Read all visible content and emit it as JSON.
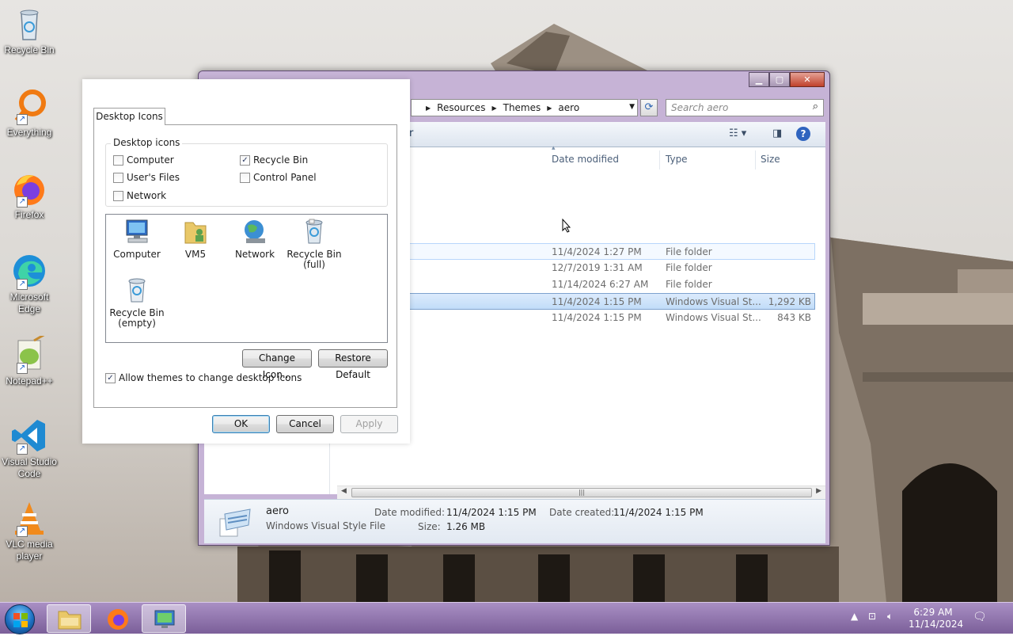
{
  "desktop": {
    "icons": [
      {
        "label": "Recycle Bin",
        "icon": "recycle-bin-icon"
      },
      {
        "label": "Everything",
        "icon": "everything-search-icon"
      },
      {
        "label": "Firefox",
        "icon": "firefox-icon"
      },
      {
        "label": "Microsoft Edge",
        "icon": "edge-icon"
      },
      {
        "label": "Notepad++",
        "icon": "notepad-plus-plus-icon"
      },
      {
        "label": "Visual Studio Code",
        "icon": "vscode-icon"
      },
      {
        "label": "VLC media player",
        "icon": "vlc-icon"
      }
    ]
  },
  "explorer": {
    "breadcrumb": [
      "Resources",
      "Themes",
      "aero"
    ],
    "search_placeholder": "Search aero",
    "toolbar_fragment": "r",
    "columns": {
      "date": "Date modified",
      "type": "Type",
      "size": "Size"
    },
    "rows": [
      {
        "date": "11/4/2024 1:27 PM",
        "type": "File folder",
        "size": ""
      },
      {
        "date": "12/7/2019 1:31 AM",
        "type": "File folder",
        "size": ""
      },
      {
        "date": "11/14/2024 6:27 AM",
        "type": "File folder",
        "size": ""
      },
      {
        "date": "11/4/2024 1:15 PM",
        "type": "Windows Visual St...",
        "size": "1,292 KB"
      },
      {
        "date": "11/4/2024 1:15 PM",
        "type": "Windows Visual St...",
        "size": "843 KB"
      }
    ],
    "details": {
      "name": "aero",
      "kind": "Windows Visual Style File",
      "date_modified_label": "Date modified:",
      "date_modified": "11/4/2024 1:15 PM",
      "date_created_label": "Date created:",
      "date_created": "11/4/2024 1:15 PM",
      "size_label": "Size:",
      "size": "1.26 MB"
    }
  },
  "dialog": {
    "tab": "Desktop Icons",
    "group_title": "Desktop icons",
    "checkboxes": [
      {
        "label": "Computer",
        "checked": false
      },
      {
        "label": "Recycle Bin",
        "checked": true
      },
      {
        "label": "User's Files",
        "checked": false
      },
      {
        "label": "Control Panel",
        "checked": false
      },
      {
        "label": "Network",
        "checked": false
      }
    ],
    "icon_items": [
      {
        "label": "Computer",
        "icon": "computer-icon"
      },
      {
        "label": "VM5",
        "icon": "user-folder-icon"
      },
      {
        "label": "Network",
        "icon": "network-icon"
      },
      {
        "label": "Recycle Bin",
        "sublabel": "(full)",
        "icon": "recycle-bin-full-icon"
      },
      {
        "label": "Recycle Bin",
        "sublabel": "(empty)",
        "icon": "recycle-bin-empty-icon"
      }
    ],
    "change_icon": "Change Icon...",
    "restore_default": "Restore Default",
    "allow_themes": "Allow themes to change desktop icons",
    "allow_themes_checked": true,
    "ok": "OK",
    "cancel": "Cancel",
    "apply": "Apply"
  },
  "taskbar": {
    "time": "6:29 AM",
    "date": "11/14/2024"
  },
  "colors": {
    "taskbar": "#8e72ad",
    "window_frame": "#c6b3d6",
    "selection": "#c1dcf8"
  }
}
